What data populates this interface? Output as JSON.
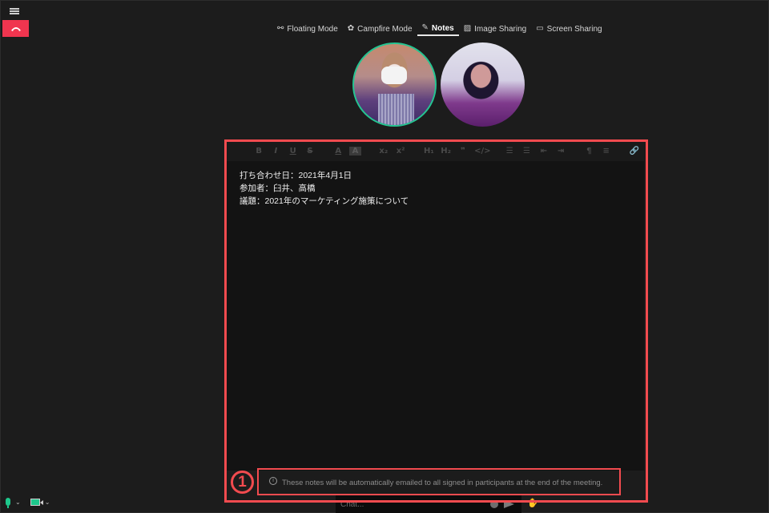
{
  "header": {
    "menu_icon": "hamburger-menu-icon",
    "hangup_icon": "phone-hangup-icon",
    "tabs": [
      {
        "label": "Floating Mode",
        "icon": "floating-mode-icon",
        "glyph": "⚯",
        "active": false
      },
      {
        "label": "Campfire Mode",
        "icon": "campfire-icon",
        "glyph": "✿",
        "active": false
      },
      {
        "label": "Notes",
        "icon": "edit-note-icon",
        "glyph": "✎",
        "active": true
      },
      {
        "label": "Image Sharing",
        "icon": "image-icon",
        "glyph": "▨",
        "active": false
      },
      {
        "label": "Screen Sharing",
        "icon": "monitor-icon",
        "glyph": "▭",
        "active": false
      }
    ]
  },
  "participants": [
    {
      "name": "participant-1",
      "speaking": true
    },
    {
      "name": "participant-2",
      "speaking": false
    }
  ],
  "editor": {
    "toolbar": [
      {
        "id": "bold",
        "glyph": "B"
      },
      {
        "id": "italic",
        "glyph": "I"
      },
      {
        "id": "underline",
        "glyph": "U"
      },
      {
        "id": "strikethrough",
        "glyph": "S"
      },
      {
        "id": "font-color",
        "glyph": "A"
      },
      {
        "id": "highlight",
        "glyph": "A"
      },
      {
        "id": "subscript",
        "glyph": "x₂"
      },
      {
        "id": "superscript",
        "glyph": "x²"
      },
      {
        "id": "heading-1",
        "glyph": "H₁"
      },
      {
        "id": "heading-2",
        "glyph": "H₂"
      },
      {
        "id": "blockquote",
        "glyph": "❞"
      },
      {
        "id": "code",
        "glyph": "</>"
      },
      {
        "id": "ordered-list",
        "glyph": "☰"
      },
      {
        "id": "bullet-list",
        "glyph": "☰"
      },
      {
        "id": "outdent",
        "glyph": "⇤"
      },
      {
        "id": "indent",
        "glyph": "⇥"
      },
      {
        "id": "text-direction",
        "glyph": "¶"
      },
      {
        "id": "align",
        "glyph": "≡"
      },
      {
        "id": "link",
        "glyph": "🔗"
      }
    ],
    "lines": [
      "打ち合わせ日：2021年4月1日",
      "参加者：臼井、高橋",
      "議題：2021年のマーケティング施策について"
    ]
  },
  "notice": {
    "text": "These notes will be automatically emailed to all signed in participants at the end of the meeting."
  },
  "annotation": {
    "number": "1",
    "color": "#f24b4f"
  },
  "chat": {
    "placeholder": "Chat..."
  },
  "colors": {
    "hangup": "#f0354f",
    "active_speaker": "#25c491",
    "mic_on": "#1ec88c"
  }
}
